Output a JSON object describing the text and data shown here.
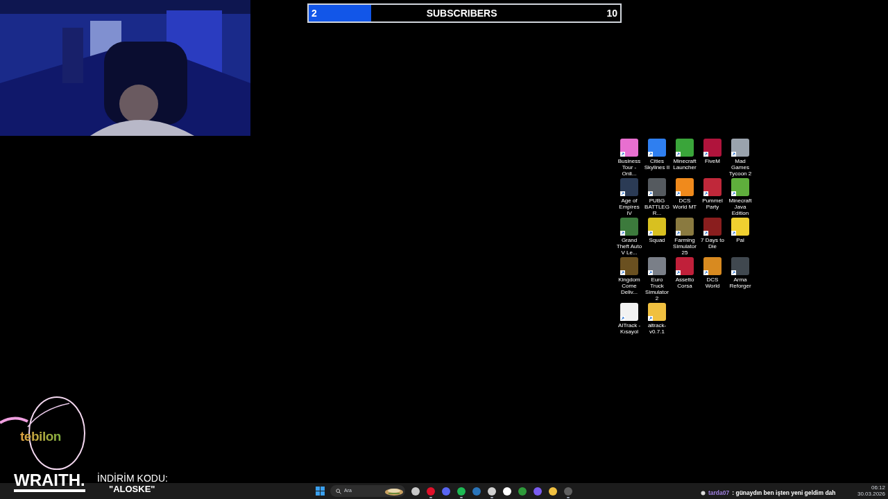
{
  "subscriber_goal": {
    "current": "2",
    "label": "SUBSCRIBERS",
    "target": "10",
    "level": 0.2
  },
  "desktop_icons": [
    {
      "label": "Business Tour - Onli...",
      "color": "#e86fd0"
    },
    {
      "label": "Cities Skylines II",
      "color": "#2f7ff0"
    },
    {
      "label": "Minecraft Launcher",
      "color": "#3aa53a"
    },
    {
      "label": "FiveM",
      "color": "#b0143c"
    },
    {
      "label": "Mad Games Tycoon 2",
      "color": "#9aa3ad"
    },
    {
      "label": "Age of Empires IV",
      "color": "#2b3b55"
    },
    {
      "label": "PUBG BATTLEGR...",
      "color": "#555a5f"
    },
    {
      "label": "DCS World MT",
      "color": "#f08a1c"
    },
    {
      "label": "Pummel Party",
      "color": "#c0283a"
    },
    {
      "label": "Minecraft Java Edition",
      "color": "#5fae3c"
    },
    {
      "label": "Grand Theft Auto V Le...",
      "color": "#3c7a3c"
    },
    {
      "label": "Squad",
      "color": "#d8c020"
    },
    {
      "label": "Farming Simulator 25",
      "color": "#8a7a40"
    },
    {
      "label": "7 Days to Die",
      "color": "#8a1e1e"
    },
    {
      "label": "Pal",
      "color": "#f0d030"
    },
    {
      "label": "Kingdom Come Deliv...",
      "color": "#6a5020"
    },
    {
      "label": "Euro Truck Simulator 2",
      "color": "#7a7f88"
    },
    {
      "label": "Assetto Corsa",
      "color": "#c0203a"
    },
    {
      "label": "DCS World",
      "color": "#d88a20"
    },
    {
      "label": "Arma Reforger",
      "color": "#40484f"
    },
    {
      "label": "AITrack - Kısayol",
      "color": "#f2f2f2"
    },
    {
      "label": "aitrack-v0.7.1",
      "color": "#f0c040"
    }
  ],
  "sponsor": {
    "brand": "tebilon",
    "product": "WRAITH.",
    "code_label": "İNDİRİM KODU:",
    "code": "\"ALOSKE\""
  },
  "taskbar": {
    "search_placeholder": "Ara",
    "apps": [
      {
        "color": "#c8c8c8",
        "running": false
      },
      {
        "color": "#e0102a",
        "running": true
      },
      {
        "color": "#5865f2",
        "running": false
      },
      {
        "color": "#1db954",
        "running": true
      },
      {
        "color": "#2a75bb",
        "running": false
      },
      {
        "color": "#d0d0d0",
        "running": true
      },
      {
        "color": "#ffffff",
        "running": false
      },
      {
        "color": "#2e9a3a",
        "running": false
      },
      {
        "color": "#7a5cf0",
        "running": false
      },
      {
        "color": "#f0c040",
        "running": false
      },
      {
        "color": "#606060",
        "running": true
      }
    ],
    "time": "06:12",
    "date": "30.03.2026"
  },
  "chat": {
    "user": "tarda07",
    "message": ": günaydın ben işten yeni geldim dah"
  }
}
